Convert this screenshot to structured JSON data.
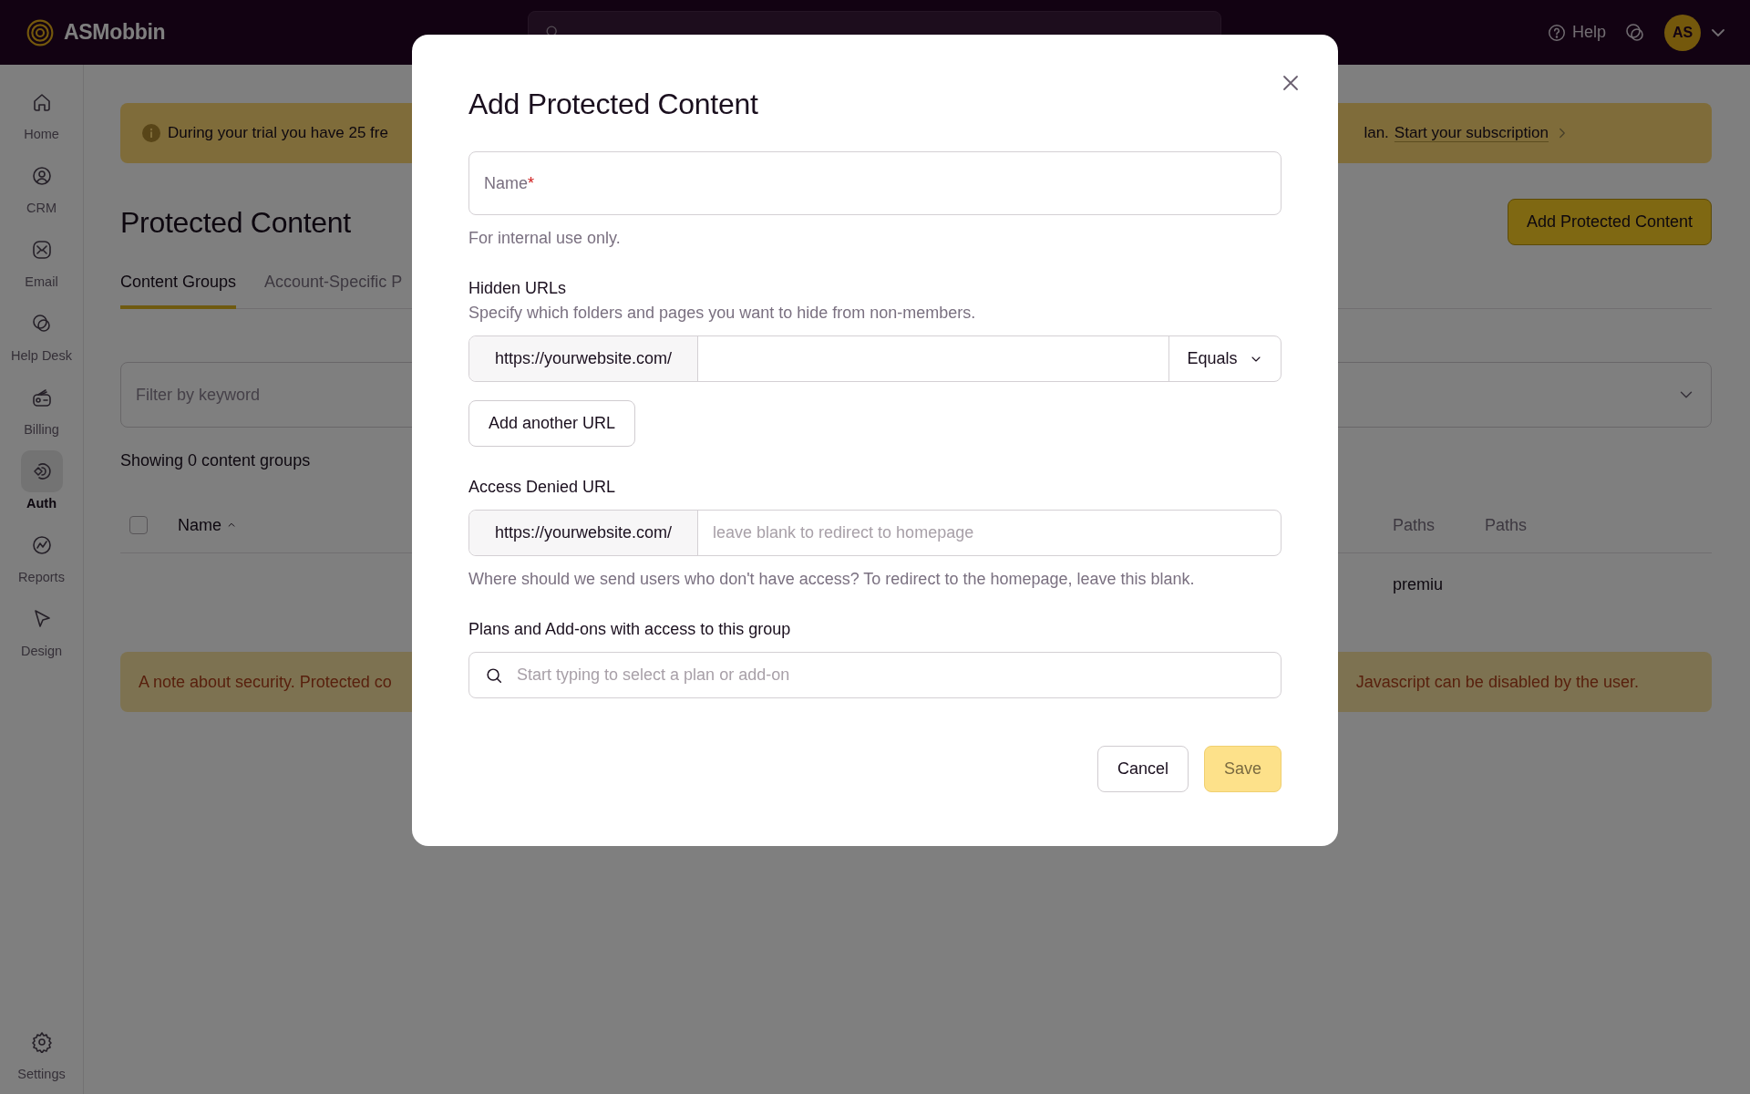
{
  "topbar": {
    "brand": "ASMobbin",
    "help": "Help",
    "avatar": "AS"
  },
  "sidebar": {
    "items": [
      {
        "label": "Home",
        "selected": false
      },
      {
        "label": "CRM",
        "selected": false
      },
      {
        "label": "Email",
        "selected": false
      },
      {
        "label": "Help Desk",
        "selected": false
      },
      {
        "label": "Billing",
        "selected": false
      },
      {
        "label": "Auth",
        "selected": true
      },
      {
        "label": "Reports",
        "selected": false
      },
      {
        "label": "Design",
        "selected": false
      }
    ],
    "footer": {
      "label": "Settings",
      "selected": false
    }
  },
  "banner": {
    "text_start": "During your trial you have 25 fre",
    "text_end": "lan.",
    "link": "Start your subscription"
  },
  "page": {
    "title": "Protected Content",
    "action": "Add Protected Content"
  },
  "tabs": [
    {
      "label": "Content Groups",
      "selected": true
    },
    {
      "label": "Account-Specific P",
      "selected": false
    }
  ],
  "filter": {
    "placeholder": "Filter by keyword"
  },
  "count": "Showing 0 content groups",
  "table": {
    "select_all": {
      "checked": false
    },
    "columns": [
      "Name",
      "Paths",
      "Paths"
    ],
    "rows": [
      {
        "cells": [
          "",
          "premiu"
        ]
      }
    ]
  },
  "security_note": {
    "text_start": "A note about security. Protected co",
    "text_end": "Javascript can be disabled by the user."
  },
  "dialog": {
    "title": "Add Protected Content",
    "name_field": {
      "label": "Name",
      "required_mark": "*",
      "help": "For internal use only."
    },
    "hidden_urls": {
      "label": "Hidden URLs",
      "description": "Specify which folders and pages you want to hide from non-members.",
      "prefix": "https://yourwebsite.com/",
      "match": "Equals",
      "add_button": "Add another URL"
    },
    "access_denied": {
      "label": "Access Denied URL",
      "prefix": "https://yourwebsite.com/",
      "placeholder": "leave blank to redirect to homepage",
      "help": "Where should we send users who don't have access? To redirect to the homepage, leave this blank."
    },
    "plans": {
      "label": "Plans and Add-ons with access to this group",
      "placeholder": "Start typing to select a plan or add-on"
    },
    "buttons": [
      {
        "label": "Cancel",
        "kind": "secondary"
      },
      {
        "label": "Save",
        "kind": "primary",
        "disabled": true
      }
    ]
  }
}
